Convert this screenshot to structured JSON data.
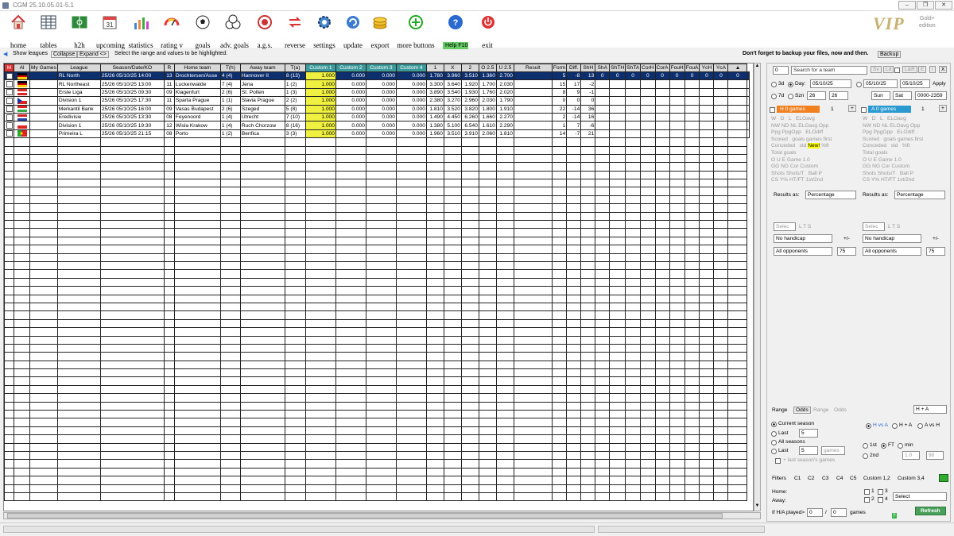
{
  "window": {
    "title": "CGM 25.10.05.01-5.1"
  },
  "toolbar": {
    "items": [
      {
        "label": "home",
        "icon": "home-icon"
      },
      {
        "label": "tables",
        "icon": "table-icon"
      },
      {
        "label": "h2h",
        "icon": "pitch-icon"
      },
      {
        "label": "upcoming",
        "icon": "calendar-icon"
      },
      {
        "label": "statistics",
        "icon": "chart-icon"
      },
      {
        "label": "rating v",
        "icon": "gauge-icon"
      },
      {
        "label": "goals",
        "icon": "ball-icon"
      },
      {
        "label": "adv. goals",
        "icon": "balls-icon"
      },
      {
        "label": "a.g.s.",
        "icon": "target-icon"
      },
      {
        "label": "reverse",
        "icon": "reverse-icon"
      },
      {
        "label": "settings",
        "icon": "gear-icon"
      },
      {
        "label": "update",
        "icon": "refresh-icon"
      },
      {
        "label": "export",
        "icon": "coins-icon"
      },
      {
        "label": "more buttons",
        "icon": "plus-icon"
      },
      {
        "label": "Help F10",
        "icon": "help-icon"
      },
      {
        "label": "exit",
        "icon": "power-icon"
      }
    ],
    "vip": "VIP",
    "edition": "Gold+ edition",
    "gold_line1": "Gold+",
    "gold_line2": "edition"
  },
  "bar2": {
    "show_leagues": "Show leagues",
    "collapse": "Collapse",
    "expand": "Expand <>",
    "hint": "Select the range and values to be highlighted.",
    "backup_note": "Don't forget to backup your files, now and then.",
    "backup_button": "Backup"
  },
  "grid": {
    "columns": [
      "M",
      "Al",
      "My Games",
      "League",
      "Season/Date/KO",
      "R",
      "Home team",
      "T(h)",
      "Away team",
      "T(a)",
      "Custom 1",
      "Custom 2",
      "Custom 3",
      "Custom 4",
      "1",
      "X",
      "2",
      "O 2.5",
      "U 2.5",
      "Result",
      "Form",
      "Diff.",
      "ShH",
      "ShA",
      "ShTH",
      "ShTA",
      "CorH",
      "CorA",
      "FouH",
      "FouA",
      "YcH",
      "YcA"
    ],
    "rows": [
      {
        "flag": "germany",
        "league": "RL North",
        "season": "25/26",
        "date": "05/10/25",
        "ko": "14:00",
        "r": "13",
        "home": "Drochtersen/Asse",
        "th": "4 (4)",
        "away": "Hannover II",
        "ta": "8 (13)",
        "c1": "1.000",
        "c2": "0.000",
        "c3": "0.000",
        "c4": "0.000",
        "o1": "1.780",
        "ox": "3.960",
        "o2": "3.510",
        "o25": "1.360",
        "u25": "2.700",
        "f1": "5",
        "f2": "-8",
        "diff": "13",
        "shh": "0",
        "sha": "0",
        "shth": "0",
        "shta": "0",
        "corh": "0",
        "cora": "0",
        "fouh": "0",
        "foua": "0",
        "ych": "0",
        "yca": "0"
      },
      {
        "flag": "germany",
        "league": "RL Northeast",
        "season": "25/26",
        "date": "05/10/25",
        "ko": "13:00",
        "r": "11",
        "home": "Luckenwalde",
        "th": "7 (4)",
        "away": "Jena",
        "ta": "1 (2)",
        "c1": "1.000",
        "c2": "0.000",
        "c3": "0.000",
        "c4": "0.000",
        "o1": "3.300",
        "ox": "3.640",
        "o2": "1.920",
        "o25": "1.700",
        "u25": "2.030",
        "f1": "15",
        "f2": "17",
        "diff": "-2"
      },
      {
        "flag": "austria",
        "league": "Erste Liga",
        "season": "25/26",
        "date": "05/10/25",
        "ko": "09:30",
        "r": "09",
        "home": "Klagenfurt",
        "th": "2 (6)",
        "away": "St. Polten",
        "ta": "1 (3)",
        "c1": "1.000",
        "c2": "0.000",
        "c3": "0.000",
        "c4": "0.000",
        "o1": "3.890",
        "ox": "3.540",
        "o2": "1.930",
        "o25": "1.760",
        "u25": "2.020",
        "f1": "8",
        "f2": "9",
        "diff": "-1"
      },
      {
        "flag": "czech",
        "league": "Division 1",
        "season": "25/26",
        "date": "05/10/25",
        "ko": "17:30",
        "r": "11",
        "home": "Sparta Prague",
        "th": "1 (1)",
        "away": "Slavia Prague",
        "ta": "2 (2)",
        "c1": "1.000",
        "c2": "0.000",
        "c3": "0.000",
        "c4": "0.000",
        "o1": "2.380",
        "ox": "3.270",
        "o2": "2.960",
        "o25": "2.030",
        "u25": "1.790",
        "f1": "0",
        "f2": "0",
        "diff": "0"
      },
      {
        "flag": "hungary",
        "league": "Merkantil Bank",
        "season": "25/26",
        "date": "05/10/25",
        "ko": "16:00",
        "r": "09",
        "home": "Vasas Budapest",
        "th": "2 (6)",
        "away": "Szeged",
        "ta": "5 (8)",
        "c1": "1.000",
        "c2": "0.000",
        "c3": "0.000",
        "c4": "0.000",
        "o1": "1.810",
        "ox": "3.520",
        "o2": "3.820",
        "o25": "1.800",
        "u25": "1.910",
        "f1": "22",
        "f2": "-14",
        "diff": "36"
      },
      {
        "flag": "netherlands",
        "league": "Eredivisie",
        "season": "25/26",
        "date": "05/10/25",
        "ko": "13:30",
        "r": "08",
        "home": "Feyenoord",
        "th": "1 (4)",
        "away": "Utrecht",
        "ta": "7 (10)",
        "c1": "1.000",
        "c2": "0.000",
        "c3": "0.000",
        "c4": "0.000",
        "o1": "1.490",
        "ox": "4.450",
        "o2": "6.260",
        "o25": "1.660",
        "u25": "2.270",
        "f1": "2",
        "f2": "-14",
        "diff": "16"
      },
      {
        "flag": "poland",
        "league": "Division 1",
        "season": "25/26",
        "date": "05/10/25",
        "ko": "19:30",
        "r": "12",
        "home": "Wisla Krakow",
        "th": "1 (4)",
        "away": "Ruch Chorzow",
        "ta": "8 (16)",
        "c1": "1.000",
        "c2": "0.000",
        "c3": "0.000",
        "c4": "0.000",
        "o1": "1.380",
        "ox": "5.100",
        "o2": "6.540",
        "o25": "1.610",
        "u25": "2.290",
        "f1": "1",
        "f2": "7",
        "diff": "-6"
      },
      {
        "flag": "portugal",
        "league": "Primeira L",
        "season": "25/26",
        "date": "05/10/25",
        "ko": "21:15",
        "r": "08",
        "home": "Porto",
        "th": "1 (2)",
        "away": "Benfica",
        "ta": "3 (3)",
        "c1": "1.000",
        "c2": "0.000",
        "c3": "0.000",
        "c4": "0.000",
        "o1": "1.960",
        "ox": "3.510",
        "o2": "3.910",
        "o25": "2.060",
        "u25": "1.810",
        "f1": "14",
        "f2": "-7",
        "diff": "21"
      }
    ]
  },
  "right": {
    "top_val": "0",
    "search_placeholder": "Search for a team",
    "sv": "Sv",
    "ld": "Ld",
    "lr": "L&R",
    "e": "E",
    "i": "I",
    "x": "X",
    "d3": "3d",
    "day": "Day:",
    "day_val": "05/10/25",
    "from_val": "05/10/25",
    "to_val": "05/10/25",
    "apply": "Apply",
    "d7": "7d",
    "szn": "Szn",
    "szn1": "26",
    "szn2": "26",
    "sun": "Sun",
    "sat": "Sat",
    "range_code": "0000-2359",
    "h_games": "H   0 games",
    "a_games": "A   0 games",
    "one": "1",
    "opts1": [
      "W",
      "D",
      "L",
      "ELOavg"
    ],
    "opts2": [
      "NW",
      "ND",
      "NL",
      "ELOavg Opp"
    ],
    "opts3": [
      "Ppg",
      "PpgOpp",
      "ELOdiff"
    ],
    "scored": "Scored",
    "conceded": "Conceded",
    "total": "Total goals",
    "goals_games_first": "goals  games  first",
    "std": "std",
    "new": "New!",
    "pft": "%ft",
    "ou": [
      "O",
      "U",
      "E",
      "Game"
    ],
    "ou_val": "1.0",
    "gg": [
      "GG",
      "NG",
      "Cor",
      "Custom"
    ],
    "shots": [
      "Shots",
      "Shots/T",
      "Ball P"
    ],
    "cs": [
      "CS",
      "Y%",
      "HT/FT",
      "1st/2nd"
    ],
    "results_as": "Results as:",
    "percentage": "Percentage",
    "select_short": "Selec",
    "ltsl": "L T S",
    "no_handicap": "No handicap",
    "pm": "+/-",
    "all_opponents": "All opponents",
    "seventyfive": "75",
    "tabs": [
      "Range",
      "Odds",
      "Range",
      "Odds"
    ],
    "ha_sel": "H + A",
    "current_season": "Current season",
    "last": "Last",
    "last_val": "5",
    "all_seasons": "All seasons",
    "games": "games",
    "last_season_games": "+ last season's games",
    "hva": "H vs A",
    "hpa": "H + A",
    "ava": "A vs H",
    "first": "1st",
    "ft": "FT",
    "min": "min",
    "second": "2nd",
    "min1": "1.0",
    "min2": "90",
    "filter_tabs": [
      "Filters",
      "C1",
      "C2",
      "C3",
      "C4",
      "C5",
      "Custom 1,2",
      "Custom 3,4"
    ],
    "home": "Home:",
    "away": "Away:",
    "n1": "1",
    "n2": "2",
    "n3": "3",
    "n4": "4",
    "select": "Select",
    "if_ha": "If H/A played>",
    "zero": "0",
    "slash": "/",
    "games2": "games",
    "refresh": "Refresh"
  }
}
